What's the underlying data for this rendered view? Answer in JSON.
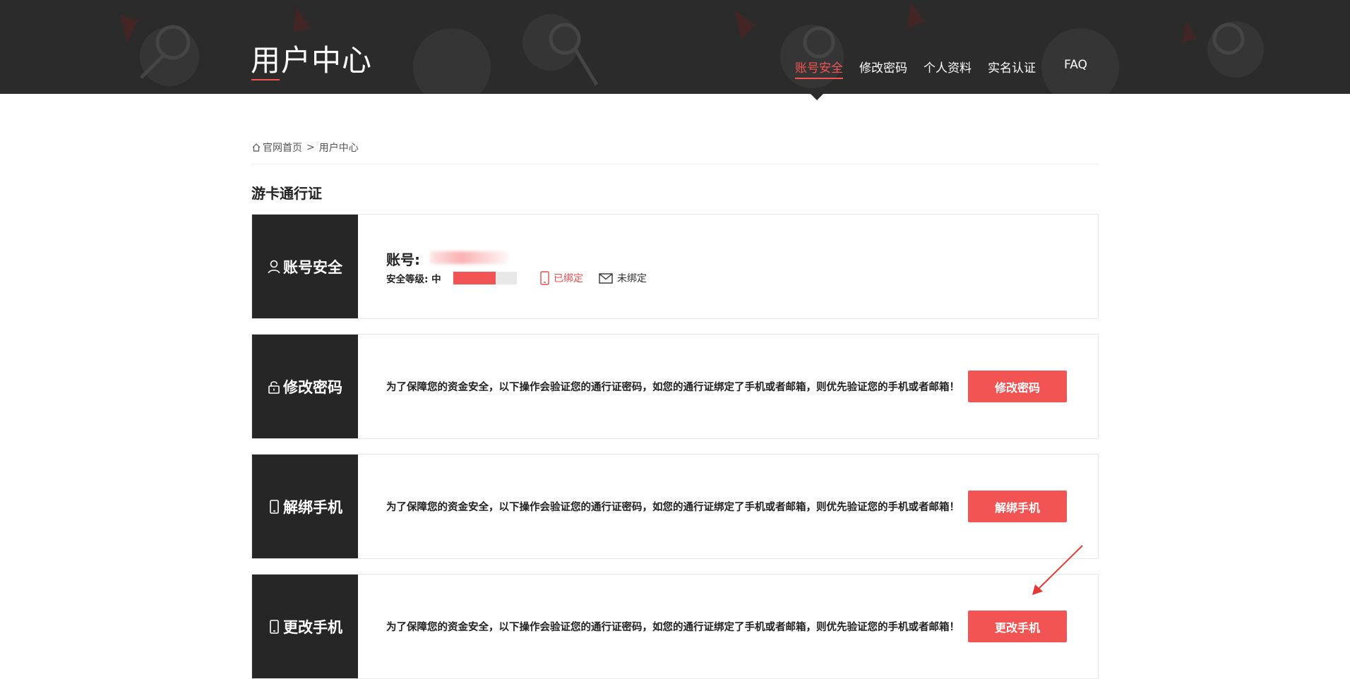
{
  "header": {
    "site_title": "用户中心",
    "nav": [
      {
        "label": "账号安全",
        "active": true
      },
      {
        "label": "修改密码",
        "active": false
      },
      {
        "label": "个人资料",
        "active": false
      },
      {
        "label": "实名认证",
        "active": false
      },
      {
        "label": "FAQ",
        "active": false
      }
    ]
  },
  "breadcrumb": {
    "home": "官网首页",
    "separator": ">",
    "current": "用户中心"
  },
  "section_title": "游卡通行证",
  "account_card": {
    "side_label": "账号安全",
    "account_label": "账号:",
    "level_label": "安全等级: 中",
    "level_fraction": 0.67,
    "phone_status": "已绑定",
    "email_status": "未绑定"
  },
  "cards": [
    {
      "side_label": "修改密码",
      "icon": "lock-icon",
      "description": "为了保障您的资金安全，以下操作会验证您的通行证密码，如您的通行证绑定了手机或者邮箱，则优先验证您的手机或者邮箱！",
      "button_label": "修改密码"
    },
    {
      "side_label": "解绑手机",
      "icon": "phone-icon",
      "description": "为了保障您的资金安全，以下操作会验证您的通行证密码，如您的通行证绑定了手机或者邮箱，则优先验证您的手机或者邮箱！",
      "button_label": "解绑手机"
    },
    {
      "side_label": "更改手机",
      "icon": "phone-icon",
      "description": "为了保障您的资金安全，以下操作会验证您的通行证密码，如您的通行证绑定了手机或者邮箱，则优先验证您的手机或者邮箱！",
      "button_label": "更改手机"
    }
  ],
  "colors": {
    "accent": "#f25353",
    "header_bg": "#2b2b2b",
    "side_bg": "#262626"
  }
}
